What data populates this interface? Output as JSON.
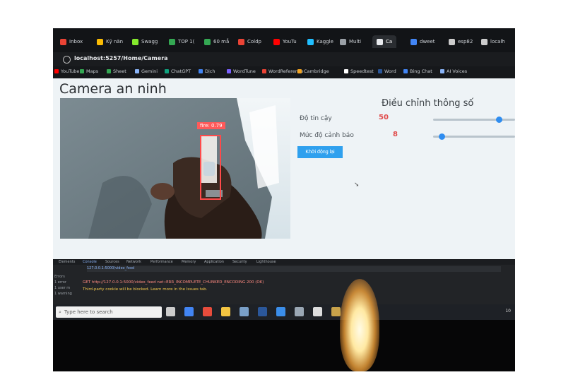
{
  "browser": {
    "tabs": [
      {
        "label": "Inbox",
        "color": "#ea4335"
      },
      {
        "label": "Kỹ năn",
        "color": "#fbbc04"
      },
      {
        "label": "Swagg",
        "color": "#85ea2d"
      },
      {
        "label": "TOP 1(",
        "color": "#34a853"
      },
      {
        "label": "60 mẫ",
        "color": "#34a853"
      },
      {
        "label": "Coldp",
        "color": "#ea4335"
      },
      {
        "label": "YouTu",
        "color": "#ff0000"
      },
      {
        "label": "Kaggle",
        "color": "#20beff"
      },
      {
        "label": "Multi",
        "color": "#9aa0a6"
      },
      {
        "label": "Ca",
        "color": "#e8eaed"
      },
      {
        "label": "dweet",
        "color": "#4285f4"
      },
      {
        "label": "esp82",
        "color": "#cccccc"
      },
      {
        "label": "localh",
        "color": "#cccccc"
      }
    ],
    "url": "localhost:5257/Home/Camera",
    "bookmarks": [
      {
        "label": "YouTube",
        "color": "#ff0000"
      },
      {
        "label": "Maps",
        "color": "#34a853"
      },
      {
        "label": "Sheet",
        "color": "#34a853"
      },
      {
        "label": "Gemini",
        "color": "#8ab4f8"
      },
      {
        "label": "ChatGPT",
        "color": "#10a37f"
      },
      {
        "label": "Dịch",
        "color": "#4285f4"
      },
      {
        "label": "WordTune",
        "color": "#7b61ff"
      },
      {
        "label": "WordReference",
        "color": "#ea4335"
      },
      {
        "label": "Cambridge",
        "color": "#f5a623"
      },
      {
        "label": "Speedtest",
        "color": "#ffffff"
      },
      {
        "label": "Word",
        "color": "#2b579a"
      },
      {
        "label": "Bing Chat",
        "color": "#4285f4"
      },
      {
        "label": "AI Voices",
        "color": "#8ab4f8"
      }
    ]
  },
  "page": {
    "title": "Camera an ninh",
    "detection_label": "fire: 0.79",
    "settings_title": "Điều chỉnh thông số",
    "confidence_label": "Độ tin cậy",
    "confidence_value": "50",
    "confidence_level": 0.8,
    "warning_label": "Mức độ cảnh báo",
    "warning_value": "8",
    "warning_level": 0.1,
    "restart_button": "Khởi động lại"
  },
  "devtools": {
    "tabs": [
      "Elements",
      "Console",
      "Sources",
      "Network",
      "Performance",
      "Memory",
      "Application",
      "Security",
      "Lighthouse"
    ],
    "active_tab": "Console",
    "url_filter": "127.0.0.1:5000/video_feed",
    "error_line": "GET http://127.0.0.1:5000/video_feed net::ERR_INCOMPLETE_CHUNKED_ENCODING 200 (OK)",
    "info_line": "Third-party cookie will be blocked. Learn more in the Issues tab.",
    "side_items": [
      "Errors",
      "1 error",
      "1 user m",
      "1 warning"
    ]
  },
  "taskbar": {
    "search_placeholder": "Type here to search",
    "icons": [
      {
        "name": "task-view-icon",
        "color": "#cccccc"
      },
      {
        "name": "chrome-icon",
        "color": "#4285f4"
      },
      {
        "name": "app-red-icon",
        "color": "#e74c3c"
      },
      {
        "name": "file-explorer-icon",
        "color": "#f4c542"
      },
      {
        "name": "app-icon",
        "color": "#7aa0c8"
      },
      {
        "name": "word-icon",
        "color": "#2b579a"
      },
      {
        "name": "vscode-icon",
        "color": "#3b8eea"
      },
      {
        "name": "app-icon",
        "color": "#9aa7b4"
      },
      {
        "name": "settings-icon",
        "color": "#dddddd"
      },
      {
        "name": "app-icon",
        "color": "#c8a24a"
      }
    ],
    "time": "10"
  }
}
